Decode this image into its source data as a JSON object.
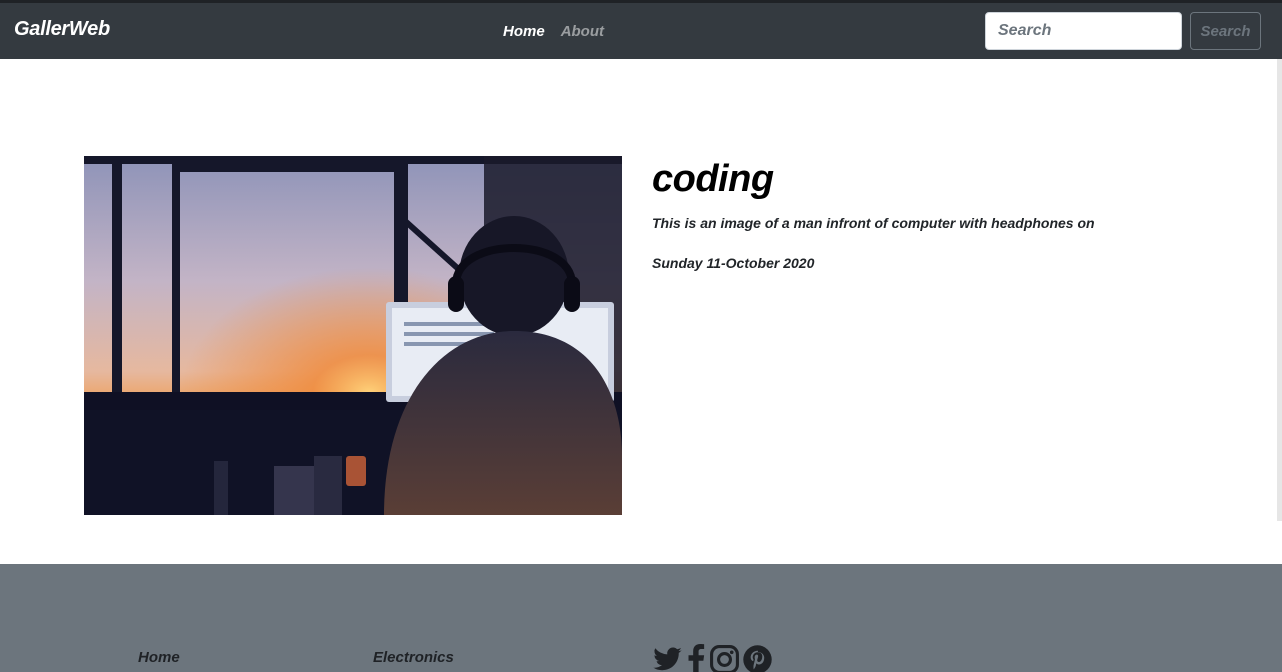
{
  "navbar": {
    "brand": "GallerWeb",
    "links": [
      {
        "label": "Home",
        "active": true
      },
      {
        "label": "About",
        "active": false
      }
    ],
    "search": {
      "placeholder": "Search",
      "button_label": "Search"
    }
  },
  "image_detail": {
    "title": "coding",
    "description": "This is an image of a man infront of computer with headphones on",
    "date": "Sunday 11-October 2020"
  },
  "footer": {
    "links": [
      "Home",
      "Electronics"
    ],
    "social_icons": [
      "twitter-icon",
      "facebook-icon",
      "instagram-icon",
      "pinterest-icon"
    ]
  },
  "colors": {
    "navbar_bg": "#343a40",
    "footer_bg": "#6c757d",
    "text": "#212529"
  }
}
